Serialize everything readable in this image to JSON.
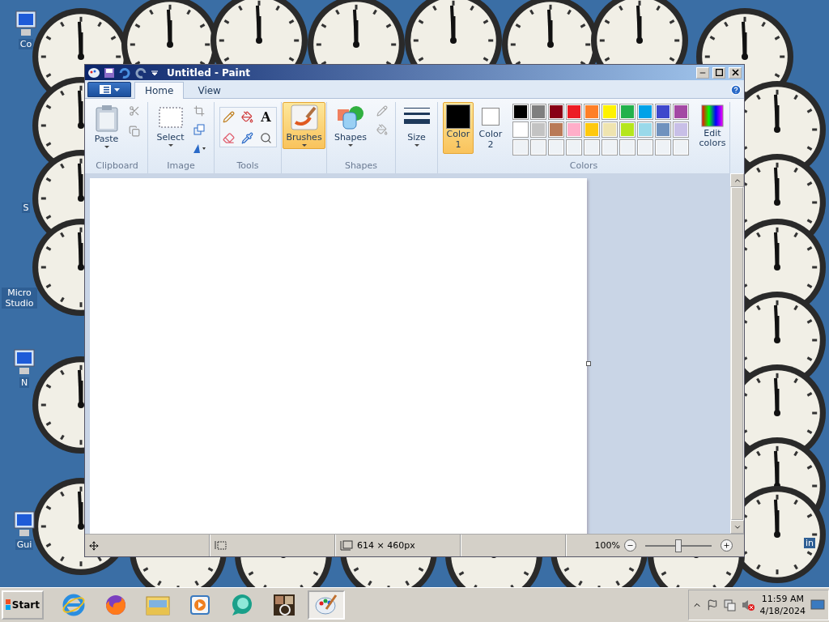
{
  "desktop": {
    "icons": [
      {
        "label": "Co"
      },
      {
        "label": "S"
      },
      {
        "label": "Micro Studio"
      },
      {
        "label": "N"
      },
      {
        "label": "Gui"
      },
      {
        "label": "in"
      }
    ]
  },
  "window": {
    "title": "Untitled - Paint",
    "tabs": [
      {
        "label": "Home",
        "selected": true
      },
      {
        "label": "View",
        "selected": false
      }
    ],
    "ribbon": {
      "clipboard": {
        "label": "Clipboard",
        "paste": "Paste"
      },
      "image": {
        "label": "Image",
        "select": "Select"
      },
      "tools": {
        "label": "Tools",
        "text_tool": "A"
      },
      "brushes": {
        "label": "Brushes",
        "selected": true
      },
      "shapes": {
        "label": "Shapes",
        "group_label": "Shapes"
      },
      "size": {
        "label": "Size"
      },
      "colors": {
        "label": "Colors",
        "edit": "Edit colors",
        "current": [
          {
            "label": "Color",
            "number": "1",
            "color": "#000000",
            "selected": true
          },
          {
            "label": "Color",
            "number": "2",
            "color": "#ffffff",
            "selected": false
          }
        ],
        "palette": [
          {
            "color": "#000000"
          },
          {
            "color": "#7f7f7f"
          },
          {
            "color": "#880015"
          },
          {
            "color": "#ed1c24"
          },
          {
            "color": "#ff7f27"
          },
          {
            "color": "#fff200"
          },
          {
            "color": "#22b14c"
          },
          {
            "color": "#00a2e8"
          },
          {
            "color": "#3f48cc"
          },
          {
            "color": "#a349a4"
          },
          {
            "color": "#ffffff"
          },
          {
            "color": "#c3c3c3"
          },
          {
            "color": "#b97a57"
          },
          {
            "color": "#ffaec9"
          },
          {
            "color": "#ffc90e"
          },
          {
            "color": "#efe4b0"
          },
          {
            "color": "#b5e61d"
          },
          {
            "color": "#99d9ea"
          },
          {
            "color": "#7092be"
          },
          {
            "color": "#c8bfe7"
          }
        ]
      }
    },
    "status_bar": {
      "size": "614 × 460px",
      "zoom": "100%",
      "zoom_slider": {
        "level": 0.5
      }
    }
  },
  "taskbar": {
    "start": "Start",
    "apps": [
      {
        "kind": "ie",
        "active": false
      },
      {
        "kind": "firefox",
        "active": false
      },
      {
        "kind": "explorer",
        "active": false
      },
      {
        "kind": "media",
        "active": false
      },
      {
        "kind": "chat",
        "active": false
      },
      {
        "kind": "gadgets",
        "active": false
      },
      {
        "kind": "paint",
        "active": true
      }
    ],
    "time": "11:59 AM",
    "date": "4/18/2024"
  }
}
